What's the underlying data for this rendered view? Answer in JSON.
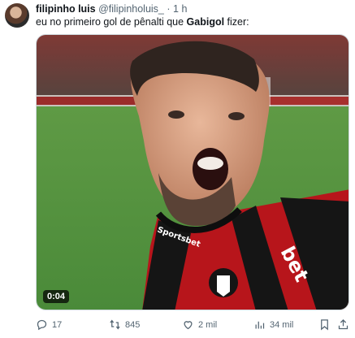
{
  "tweet": {
    "author_name": "filipinho luis",
    "handle": "@filipinholuis_",
    "separator": "·",
    "time": "1 h",
    "text_before": "eu no primeiro gol de pênalti que ",
    "text_bold": "Gabigol",
    "text_after": " fizer:"
  },
  "video": {
    "duration": "0:04",
    "sponsor_back": "bet",
    "sponsor_left": "Sportsbet"
  },
  "actions": {
    "replies": "17",
    "reposts": "845",
    "likes": "2 mil",
    "views": "34 mil"
  }
}
